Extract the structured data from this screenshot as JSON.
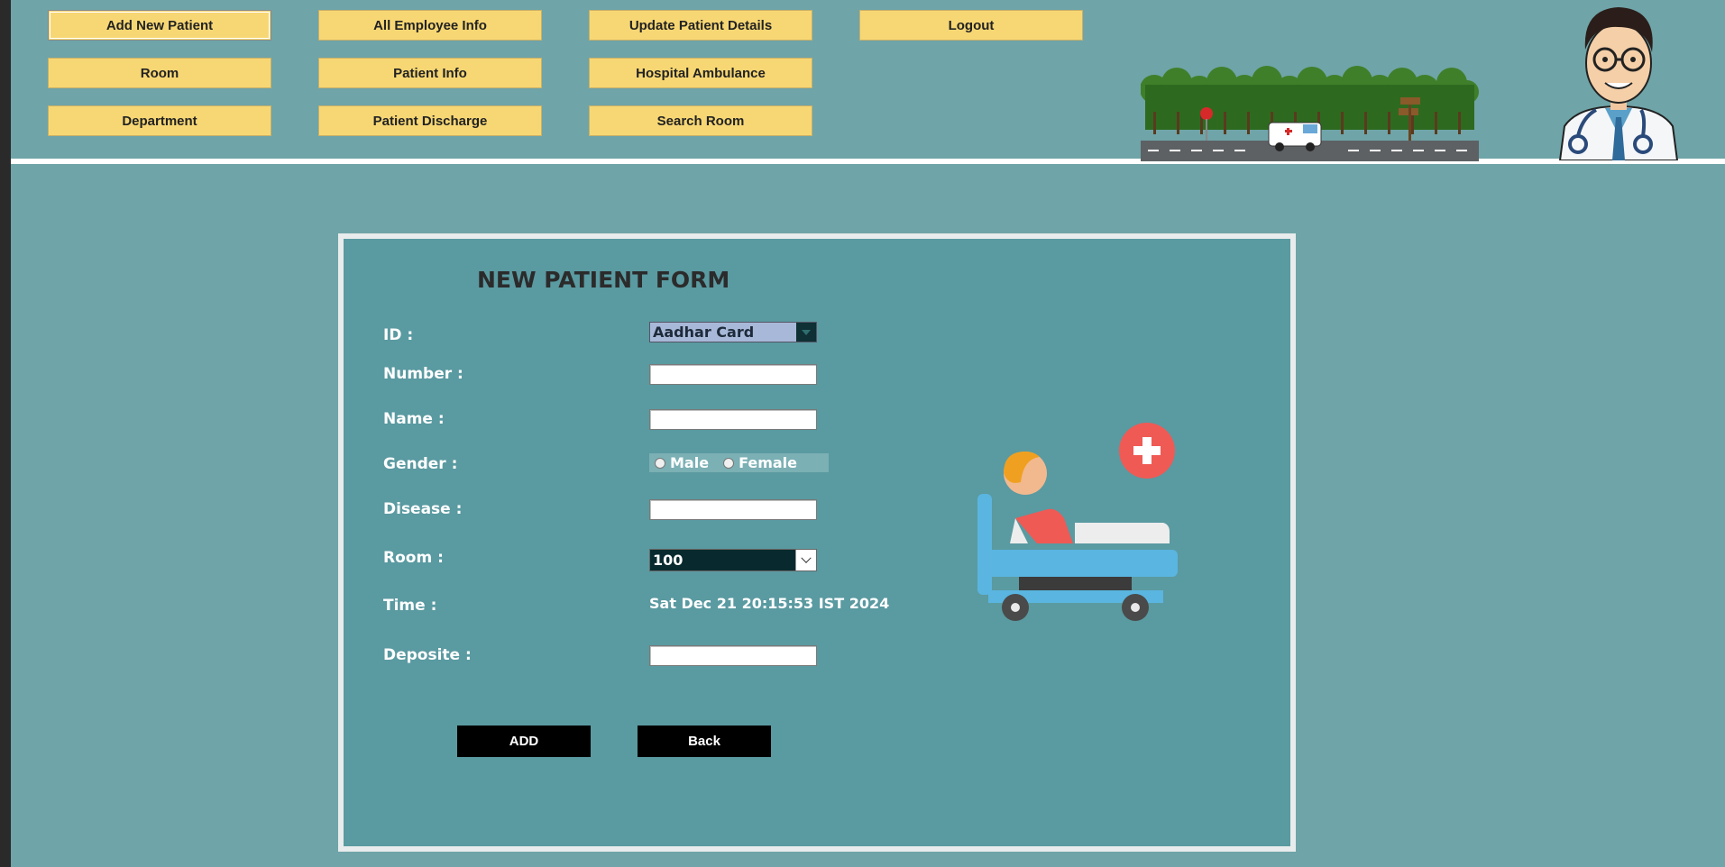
{
  "nav": {
    "add_new_patient": "Add New Patient",
    "all_employee_info": "All Employee Info",
    "update_patient_details": "Update Patient Details",
    "logout": "Logout",
    "room": "Room",
    "patient_info": "Patient Info",
    "hospital_ambulance": "Hospital Ambulance",
    "department": "Department",
    "patient_discharge": "Patient Discharge",
    "search_room": "Search Room"
  },
  "form": {
    "title": "NEW PATIENT FORM",
    "labels": {
      "id": "ID :",
      "number": "Number :",
      "name": "Name :",
      "gender": "Gender :",
      "disease": "Disease :",
      "room": "Room :",
      "time": "Time :",
      "deposite": "Deposite :"
    },
    "id_selected": "Aadhar Card",
    "number_value": "",
    "name_value": "",
    "disease_value": "",
    "deposite_value": "",
    "gender_options": [
      "Male",
      "Female"
    ],
    "room_selected": "100",
    "time_value": "Sat Dec 21 20:15:53 IST 2024",
    "add_button": "ADD",
    "back_button": "Back"
  },
  "colors": {
    "background": "#6fa4a8",
    "panel": "#5a9aa1",
    "nav_button": "#f7d774",
    "action_button": "#000000"
  },
  "icons": [
    "forest-road-ambulance-illustration",
    "doctor-avatar-illustration",
    "patient-bed-illustration",
    "medical-cross-icon"
  ]
}
